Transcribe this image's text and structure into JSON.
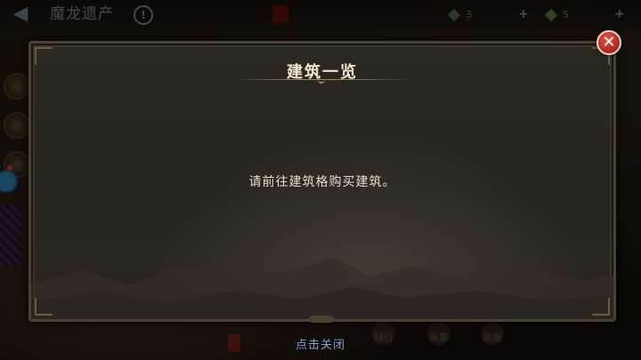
{
  "topbar": {
    "back_icon": "back-arrow-icon",
    "title": "魔龙遗产",
    "info_icon": "info-icon",
    "resources": [
      {
        "icon": "green-gem-icon",
        "value": "3"
      },
      {
        "icon": "green-leaf-icon",
        "value": "5"
      }
    ]
  },
  "panel": {
    "title": "建筑一览",
    "message": "请前往建筑格购买建筑。",
    "close_icon": "close-icon"
  },
  "footer": {
    "close_hint": "点击关闭",
    "tabs": [
      "排行",
      "采集",
      "装备"
    ]
  },
  "colors": {
    "title": "#f2e6cc",
    "message": "#e6ddcc",
    "close_hint": "#7f9cdb",
    "close_button": "#c4302b"
  }
}
